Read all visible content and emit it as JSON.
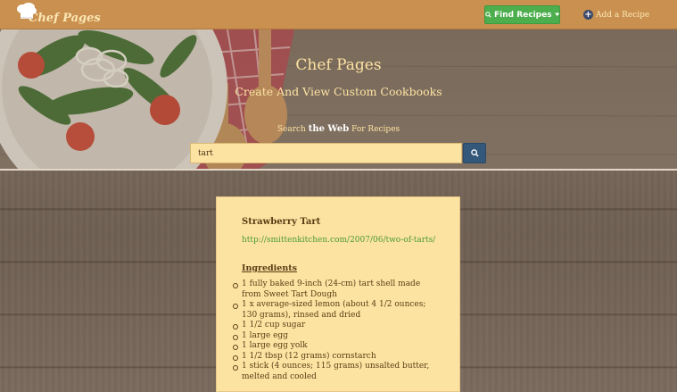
{
  "navbar": {
    "brand": "Chef Pages",
    "find_recipes_label": "Find Recipes",
    "add_recipe_label": "Add a Recipe"
  },
  "hero": {
    "title": "Chef Pages",
    "subtitle": "Create And View Custom Cookbooks",
    "search_label_pre": "Search ",
    "search_label_em": "the Web",
    "search_label_post": " For Recipes"
  },
  "search": {
    "value": "tart"
  },
  "recipe": {
    "title": "Strawberry Tart",
    "url": "http://smittenkitchen.com/2007/06/two-of-tarts/",
    "ingredients_heading": "Ingredients",
    "ingredients": [
      "1 fully baked 9-inch (24-cm) tart shell made from Sweet Tart Dough",
      "1 x average-sized lemon (about 4 1/2 ounces; 130 grams), rinsed and dried",
      "1 1/2 cup sugar",
      "1 large egg",
      "1 large egg yolk",
      "1 1/2 tbsp (12 grams) cornstarch",
      "1 stick (4 ounces; 115 grams) unsalted butter, melted and cooled"
    ]
  },
  "colors": {
    "navbar": "#c9904f",
    "accent_green": "#4cae4c",
    "cream": "#fde3a2",
    "search_button": "#34587a"
  },
  "icons": {
    "brand": "chef-hat-icon",
    "find": "search-icon",
    "dropdown": "caret-down-icon",
    "add": "plus-circle-icon",
    "search_button": "search-icon"
  }
}
